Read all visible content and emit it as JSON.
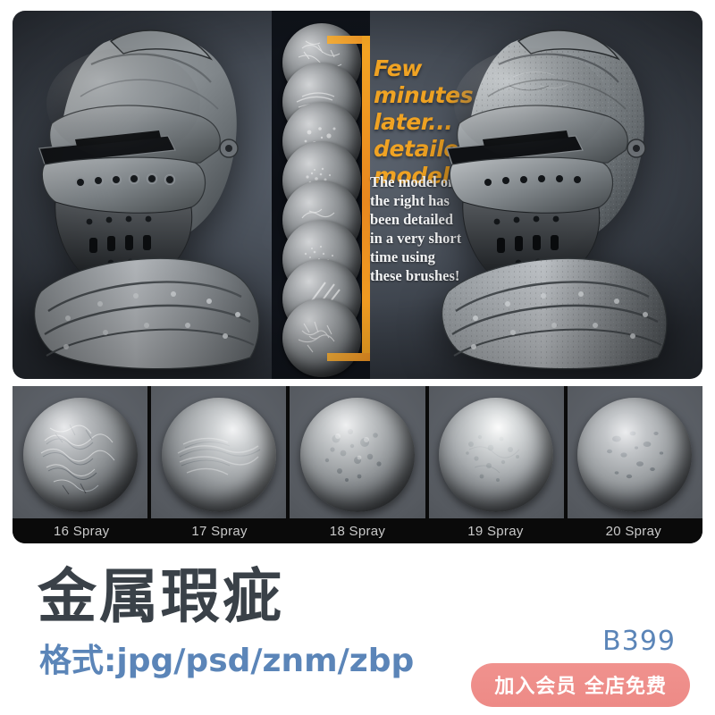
{
  "hero": {
    "headline": "Few minutes later... detailed model!",
    "body": "The model on the right has been detailed in a very short time using these brushes!",
    "accent_color": "#f0a323",
    "background_color": "#4b525c",
    "strip_background": "#0b0e14",
    "left_model_name": "base-knight-helmet",
    "right_model_name": "detailed-knight-helmet",
    "preview_spheres": [
      {
        "name": "sphere-preview-1"
      },
      {
        "name": "sphere-preview-2"
      },
      {
        "name": "sphere-preview-3"
      },
      {
        "name": "sphere-preview-4"
      },
      {
        "name": "sphere-preview-5"
      },
      {
        "name": "sphere-preview-6"
      },
      {
        "name": "sphere-preview-7"
      },
      {
        "name": "sphere-preview-8"
      }
    ]
  },
  "thumbnails": {
    "items": [
      {
        "label": "16 Spray"
      },
      {
        "label": "17 Spray"
      },
      {
        "label": "18 Spray"
      },
      {
        "label": "19 Spray"
      },
      {
        "label": "20 Spray"
      }
    ],
    "label_color": "#c9c9c9",
    "background_color": "#0a0a0a"
  },
  "footer": {
    "title": "金属瑕疵",
    "title_color": "#3a4148",
    "format": "格式:jpg/psd/znm/zbp",
    "format_color": "#5b85b8",
    "code": "B399",
    "cta_label": "加入会员 全店免费",
    "cta_color": "#ed8a86"
  }
}
